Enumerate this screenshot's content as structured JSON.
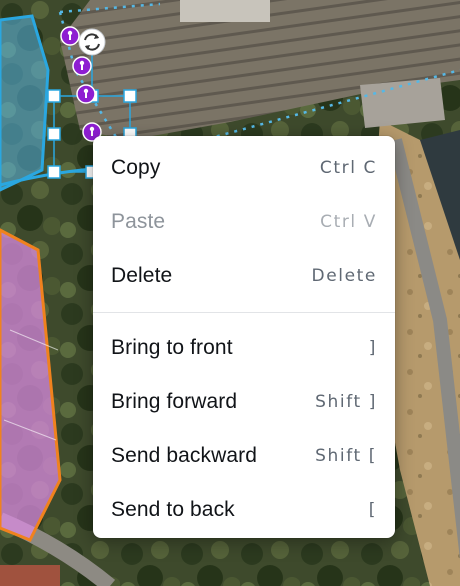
{
  "context_menu": {
    "groups": [
      [
        {
          "label": "Copy",
          "shortcut": "Ctrl C",
          "enabled": true
        },
        {
          "label": "Paste",
          "shortcut": "Ctrl V",
          "enabled": false
        },
        {
          "label": "Delete",
          "shortcut": "Delete",
          "enabled": true
        }
      ],
      [
        {
          "label": "Bring to front",
          "shortcut": "]",
          "enabled": true
        },
        {
          "label": "Bring forward",
          "shortcut": "Shift ]",
          "enabled": true
        },
        {
          "label": "Send backward",
          "shortcut": "Shift [",
          "enabled": true
        },
        {
          "label": "Send to back",
          "shortcut": "[",
          "enabled": true
        }
      ]
    ]
  },
  "colors": {
    "selection_blue": "#2aa7e0",
    "marker_purple": "#8e1ed1",
    "pink_area": "#d98be0",
    "orange_outline": "#f0821e"
  }
}
